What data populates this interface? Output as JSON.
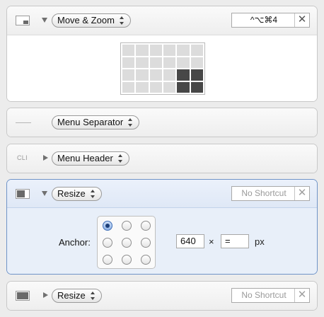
{
  "cards": {
    "move_zoom": {
      "action_label": "Move & Zoom",
      "shortcut": "^⌥⌘4",
      "clear_glyph": "✕",
      "grid": {
        "columns": 6,
        "rows": 4,
        "selected_cells": [
          [
            4,
            2
          ],
          [
            5,
            2
          ],
          [
            4,
            3
          ],
          [
            5,
            3
          ]
        ]
      }
    },
    "separator": {
      "action_label": "Menu Separator"
    },
    "header": {
      "thumb_label": "CLI",
      "action_label": "Menu Header"
    },
    "resize_expanded": {
      "action_label": "Resize",
      "shortcut_placeholder": "No Shortcut",
      "clear_glyph": "✕",
      "anchor_label": "Anchor:",
      "selected_anchor": "top-left",
      "width_value": "640",
      "times_symbol": "×",
      "height_value": "=",
      "unit_label": "px"
    },
    "resize_collapsed": {
      "action_label": "Resize",
      "shortcut_placeholder": "No Shortcut",
      "clear_glyph": "✕"
    }
  },
  "colors": {
    "selection_border": "#6f93c8",
    "grid_selected": "#474747",
    "grid_unselected": "#dcdcdc",
    "radio_selected": "#3f6fb7"
  }
}
